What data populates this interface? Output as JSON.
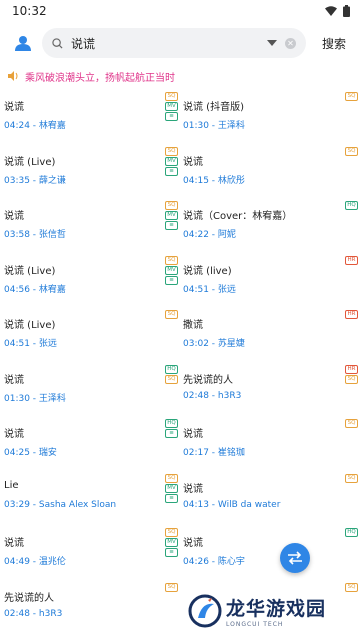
{
  "status_bar": {
    "time": "10:32"
  },
  "search": {
    "query": "说谎",
    "button_label": "搜索"
  },
  "notice": {
    "text": "乘风破浪潮头立，扬帆起航正当时"
  },
  "songs": [
    {
      "title": "说谎",
      "duration": "04:24",
      "artist": "林宥嘉",
      "badges": [
        "SQ",
        "MV",
        "lyric"
      ]
    },
    {
      "title": "说谎 (抖音版)",
      "duration": "01:30",
      "artist": "王泽科",
      "badges": [
        "SQ"
      ]
    },
    {
      "title": "说谎 (Live)",
      "duration": "03:35",
      "artist": "薛之谦",
      "badges": [
        "SQ",
        "MV",
        "lyric"
      ]
    },
    {
      "title": "说谎",
      "duration": "04:15",
      "artist": "林欣彤",
      "badges": [
        "SQ"
      ]
    },
    {
      "title": "说谎",
      "duration": "03:58",
      "artist": "张信哲",
      "badges": [
        "SQ",
        "MV",
        "lyric"
      ]
    },
    {
      "title": "说谎（Cover：林宥嘉）",
      "duration": "04:22",
      "artist": "阿妮",
      "badges": [
        "HQ"
      ]
    },
    {
      "title": "说谎 (Live)",
      "duration": "04:56",
      "artist": "林宥嘉",
      "badges": [
        "SQ",
        "MV",
        "lyric"
      ]
    },
    {
      "title": "说谎 (live)",
      "duration": "04:51",
      "artist": "张远",
      "badges": [
        "HR"
      ]
    },
    {
      "title": "说谎 (Live)",
      "duration": "04:51",
      "artist": "张远",
      "badges": [
        "SQ"
      ]
    },
    {
      "title": "撒谎",
      "duration": "03:02",
      "artist": "苏星婕",
      "badges": [
        "HR"
      ]
    },
    {
      "title": "说谎",
      "duration": "01:30",
      "artist": "王泽科",
      "badges": [
        "HQ",
        "SQ"
      ]
    },
    {
      "title": "先说谎的人",
      "duration": "02:48",
      "artist": "h3R3",
      "badges": [
        "HR",
        "SQ"
      ]
    },
    {
      "title": "说谎",
      "duration": "04:25",
      "artist": "瑞安",
      "badges": [
        "HQ",
        "lyric"
      ]
    },
    {
      "title": "说谎",
      "duration": "02:17",
      "artist": "崔铭珈",
      "badges": [
        "SQ"
      ]
    },
    {
      "title": "Lie",
      "duration": "03:29",
      "artist": "Sasha Alex Sloan",
      "badges": [
        "SQ",
        "MV",
        "lyric"
      ]
    },
    {
      "title": "说谎",
      "duration": "04:13",
      "artist": "WilB da water",
      "badges": [
        "SQ"
      ]
    },
    {
      "title": "说谎",
      "duration": "04:49",
      "artist": "温兆伦",
      "badges": [
        "SQ",
        "MV",
        "lyric"
      ]
    },
    {
      "title": "说谎",
      "duration": "04:26",
      "artist": "陈心宇",
      "badges": [
        "HQ"
      ]
    },
    {
      "title": "先说谎的人",
      "duration": "02:48",
      "artist": "h3R3",
      "badges": [
        "SQ"
      ]
    },
    {
      "title": "",
      "duration": "",
      "artist": "",
      "badges": [
        "SQ"
      ]
    }
  ],
  "watermark": {
    "title": "龙华游戏园",
    "subtitle": "LONGCUI TECH"
  },
  "icons": {
    "avatar": "user-icon",
    "search": "search-icon",
    "dropdown": "dropdown-icon",
    "clear": "clear-icon",
    "notice": "speaker-icon",
    "fab": "swap-icon"
  },
  "colors": {
    "accent": "#2f86e6",
    "meta": "#1e7ad8",
    "notice": "#e0348a"
  }
}
